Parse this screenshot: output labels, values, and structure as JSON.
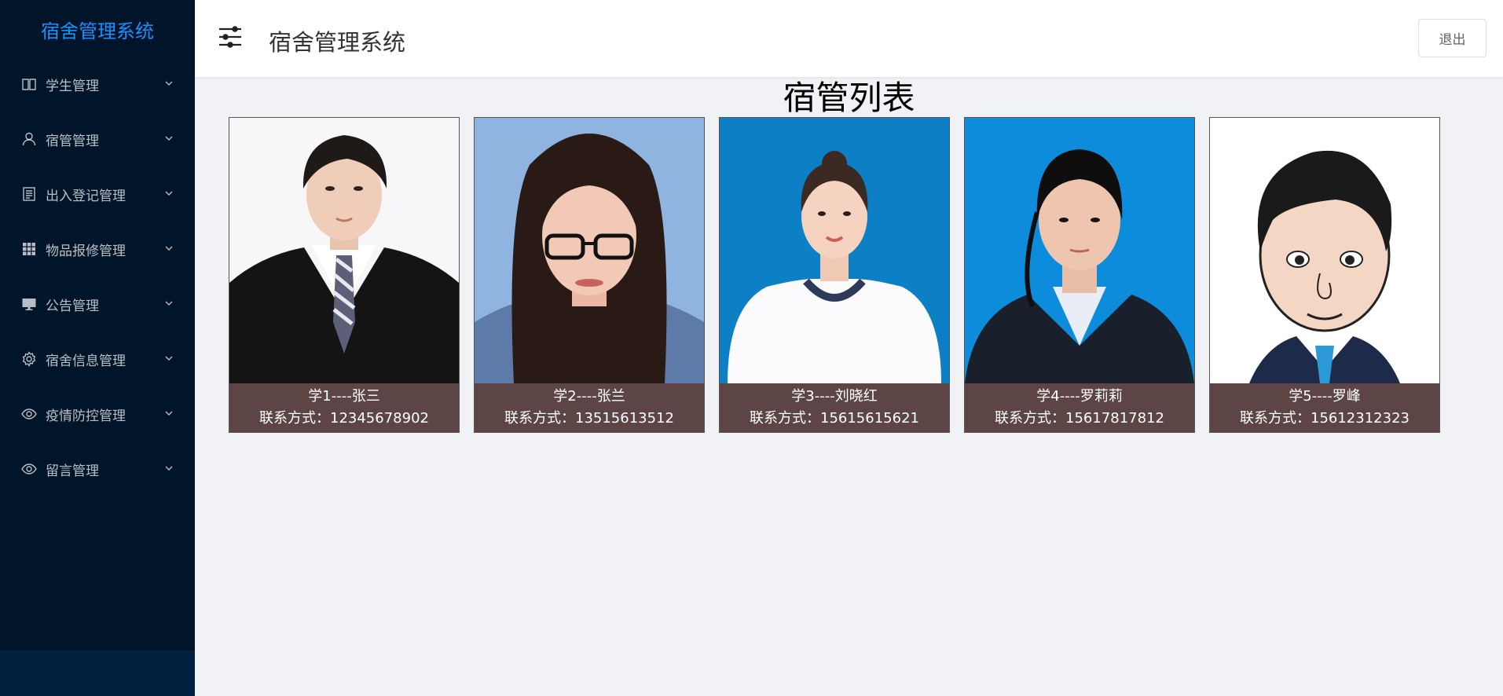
{
  "app": {
    "logo_text": "宿舍管理系统",
    "header_title": "宿舍管理系统",
    "logout_label": "退出"
  },
  "sidebar": {
    "items": [
      {
        "label": "学生管理",
        "icon": "book-icon"
      },
      {
        "label": "宿管管理",
        "icon": "user-icon"
      },
      {
        "label": "出入登记管理",
        "icon": "document-icon"
      },
      {
        "label": "物品报修管理",
        "icon": "grid-icon"
      },
      {
        "label": "公告管理",
        "icon": "monitor-icon"
      },
      {
        "label": "宿舍信息管理",
        "icon": "gear-icon"
      },
      {
        "label": "疫情防控管理",
        "icon": "eye-icon"
      },
      {
        "label": "留言管理",
        "icon": "eye-icon"
      }
    ]
  },
  "main": {
    "page_title": "宿管列表",
    "cards": [
      {
        "name_line": "学1----张三",
        "contact_label": "联系方式：",
        "contact": "12345678902"
      },
      {
        "name_line": "学2----张兰",
        "contact_label": "联系方式：",
        "contact": "13515613512"
      },
      {
        "name_line": "学3----刘晓红",
        "contact_label": "联系方式：",
        "contact": "15615615621"
      },
      {
        "name_line": "学4----罗莉莉",
        "contact_label": "联系方式：",
        "contact": "15617817812"
      },
      {
        "name_line": "学5----罗峰",
        "contact_label": "联系方式：",
        "contact": "15612312323"
      }
    ]
  },
  "colors": {
    "sidebar_bg": "#001529",
    "accent": "#1890ff",
    "caption_bg": "#5d4545",
    "page_bg": "#f0f2f5"
  }
}
